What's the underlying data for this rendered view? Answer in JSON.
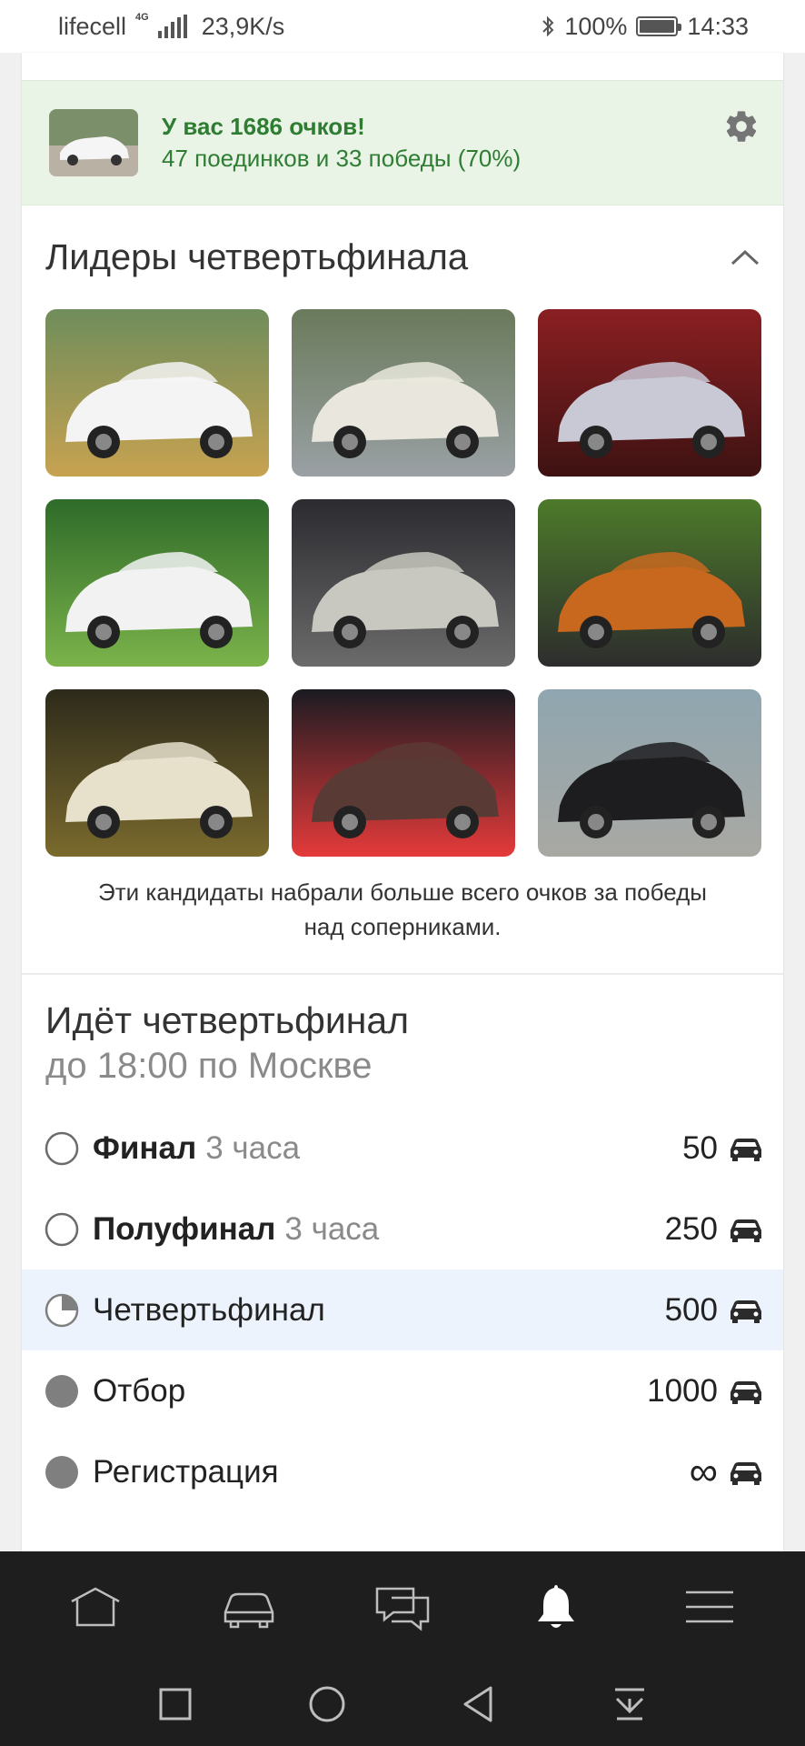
{
  "status_bar": {
    "carrier": "lifecell",
    "network": "4G",
    "speed": "23,9K/s",
    "battery": "100%",
    "time": "14:33"
  },
  "score": {
    "title": "У вас 1686 очков!",
    "subtitle": "47 поединков и 33 победы (70%)",
    "settings_icon": "gear-icon"
  },
  "leaders": {
    "title": "Лидеры четвертьфинала",
    "toggle_icon": "chevron-up-icon",
    "photos": [
      {
        "name": "leader-photo-1",
        "colors": [
          "#6f8d5b",
          "#f4f4f4",
          "#c7a250"
        ]
      },
      {
        "name": "leader-photo-2",
        "colors": [
          "#6a7a5b",
          "#e9e7dd",
          "#9aa0a4"
        ]
      },
      {
        "name": "leader-photo-3",
        "colors": [
          "#8a1f22",
          "#c9c9d6",
          "#3e1212"
        ]
      },
      {
        "name": "leader-photo-4",
        "colors": [
          "#2f6b2a",
          "#f2f2f2",
          "#7bb34a"
        ]
      },
      {
        "name": "leader-photo-5",
        "colors": [
          "#2b2b30",
          "#c8c8c0",
          "#6b6b6b"
        ]
      },
      {
        "name": "leader-photo-6",
        "colors": [
          "#4d7a2a",
          "#c8681e",
          "#2d2d2d"
        ]
      },
      {
        "name": "leader-photo-7",
        "colors": [
          "#2d2a1b",
          "#e7e1cc",
          "#7a6a2d"
        ]
      },
      {
        "name": "leader-photo-8",
        "colors": [
          "#1b1b22",
          "#5a3a35",
          "#e53a3a"
        ]
      },
      {
        "name": "leader-photo-9",
        "colors": [
          "#8fa6b0",
          "#1d1d20",
          "#a9a8a3"
        ]
      }
    ],
    "caption": "Эти кандидаты набрали больше всего очков за победы над соперниками."
  },
  "stage_block": {
    "title": "Идёт четвертьфинал",
    "subtitle": "до 18:00 по Москве",
    "stages": [
      {
        "name": "Финал",
        "duration": "3 часа",
        "value": "50",
        "state": "pending"
      },
      {
        "name": "Полуфинал",
        "duration": "3 часа",
        "value": "250",
        "state": "pending"
      },
      {
        "name": "Четвертьфинал",
        "duration": "",
        "value": "500",
        "state": "current"
      },
      {
        "name": "Отбор",
        "duration": "",
        "value": "1000",
        "state": "done"
      },
      {
        "name": "Регистрация",
        "duration": "",
        "value": "∞",
        "state": "done"
      }
    ]
  },
  "bottom_nav": [
    {
      "name": "home-icon",
      "active": false
    },
    {
      "name": "car-icon",
      "active": false
    },
    {
      "name": "messages-icon",
      "active": false
    },
    {
      "name": "bell-icon",
      "active": true
    },
    {
      "name": "menu-icon",
      "active": false
    }
  ],
  "system_nav": [
    "recent-apps-icon",
    "home-circle-icon",
    "back-icon",
    "notifications-down-icon"
  ]
}
